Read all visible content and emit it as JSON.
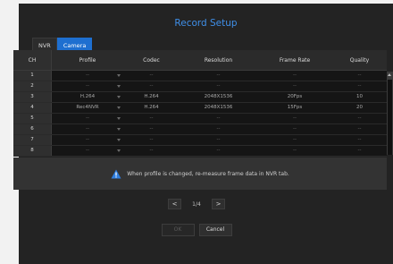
{
  "dialog": {
    "title": "Record Setup"
  },
  "tabs": [
    {
      "label": "NVR",
      "active": false
    },
    {
      "label": "Camera",
      "active": true
    }
  ],
  "table": {
    "headers": [
      "CH",
      "Profile",
      "Codec",
      "Resolution",
      "Frame Rate",
      "Quality"
    ],
    "rows": [
      [
        "1",
        "--",
        "--",
        "--",
        "--",
        "--"
      ],
      [
        "2",
        "--",
        "--",
        "--",
        "--",
        "--"
      ],
      [
        "3",
        "H.264",
        "H.264",
        "2048X1536",
        "20Fps",
        "10"
      ],
      [
        "4",
        "Rec4NVR",
        "H.264",
        "2048X1536",
        "15Fps",
        "20"
      ],
      [
        "5",
        "--",
        "--",
        "--",
        "--",
        "--"
      ],
      [
        "6",
        "--",
        "--",
        "--",
        "--",
        "--"
      ],
      [
        "7",
        "--",
        "--",
        "--",
        "--",
        "--"
      ],
      [
        "8",
        "--",
        "--",
        "--",
        "--",
        "--"
      ]
    ]
  },
  "notice": {
    "text": "When profile is changed, re-measure frame data in NVR tab.",
    "icon": "warning-icon"
  },
  "pagination": {
    "prev": "<",
    "page": "1/4",
    "next": ">"
  },
  "buttons": {
    "ok": "OK",
    "cancel": "Cancel"
  },
  "colors": {
    "accent": "#1e6fd0",
    "title": "#3f8fe8",
    "warning": "#2f7fe0"
  }
}
